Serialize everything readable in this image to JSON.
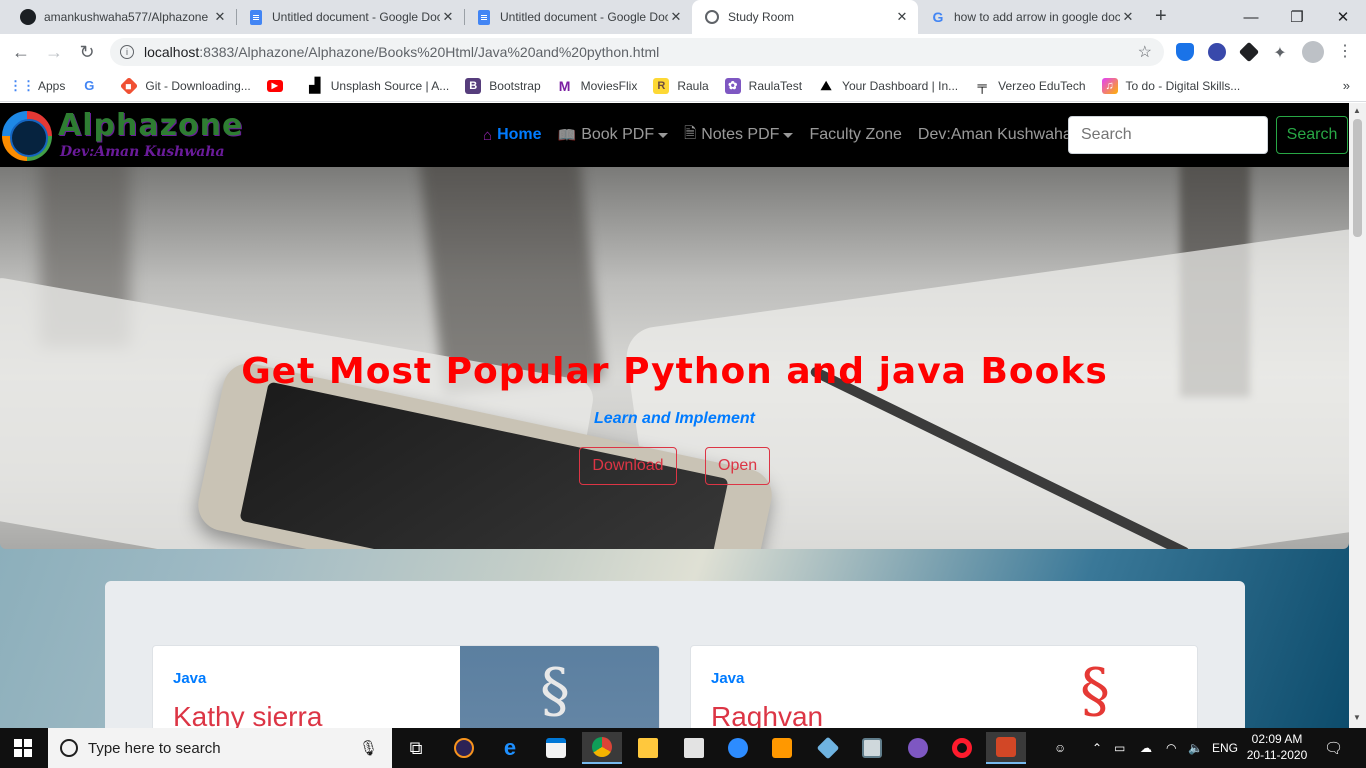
{
  "browser": {
    "tabs": [
      {
        "title": "amankushwaha577/Alphazone",
        "icon": "github-icon"
      },
      {
        "title": "Untitled document - Google Docs",
        "icon": "google-docs-icon"
      },
      {
        "title": "Untitled document - Google Docs",
        "icon": "google-docs-icon"
      },
      {
        "title": "Study Room",
        "icon": "globe-icon",
        "active": true
      },
      {
        "title": "how to add arrow in google docs",
        "icon": "google-icon"
      }
    ],
    "url_host": "localhost",
    "url_path": ":8383/Alphazone/Alphazone/Books%20Html/Java%20and%20python.html",
    "bookmarks": [
      {
        "label": "Apps",
        "icon": "apps-grid-icon"
      },
      {
        "label": "",
        "icon": "google-icon"
      },
      {
        "label": "Git - Downloading...",
        "icon": "git-icon"
      },
      {
        "label": "",
        "icon": "youtube-icon"
      },
      {
        "label": "Unsplash Source | A...",
        "icon": "unsplash-icon"
      },
      {
        "label": "Bootstrap",
        "icon": "bootstrap-icon"
      },
      {
        "label": "MoviesFlix",
        "icon": "moviesflix-icon"
      },
      {
        "label": "Raula",
        "icon": "raula-icon"
      },
      {
        "label": "RaulaTest",
        "icon": "raulatest-icon"
      },
      {
        "label": "Your Dashboard | In...",
        "icon": "dashboard-icon"
      },
      {
        "label": "Verzeo EduTech",
        "icon": "verzeo-icon"
      },
      {
        "label": "To do - Digital Skills...",
        "icon": "todo-icon"
      }
    ],
    "bookmarks_more": "»"
  },
  "site": {
    "brand_title": "Alphazone",
    "brand_subtitle": "Dev:Aman Kushwaha",
    "nav": {
      "home": "Home",
      "book_pdf": "Book PDF",
      "notes_pdf": "Notes PDF",
      "faculty": "Faculty Zone",
      "dev": "Dev:Aman Kushwaha"
    },
    "search_placeholder": "Search",
    "search_button": "Search"
  },
  "hero": {
    "title": "Get Most Popular Python and java Books",
    "subtitle": "Learn and Implement",
    "download_button": "Download",
    "open_button": "Open"
  },
  "cards": [
    {
      "category": "Java",
      "author": "Kathy sierra"
    },
    {
      "category": "Java",
      "author": "Raghvan"
    }
  ],
  "taskbar": {
    "search_placeholder": "Type here to search",
    "language": "ENG",
    "time": "02:09 AM",
    "date": "20-11-2020"
  },
  "colors": {
    "hero_title": "#ff0000",
    "nav_active": "#007bff",
    "outline_red": "#dc3545",
    "outline_green": "#28a745"
  }
}
